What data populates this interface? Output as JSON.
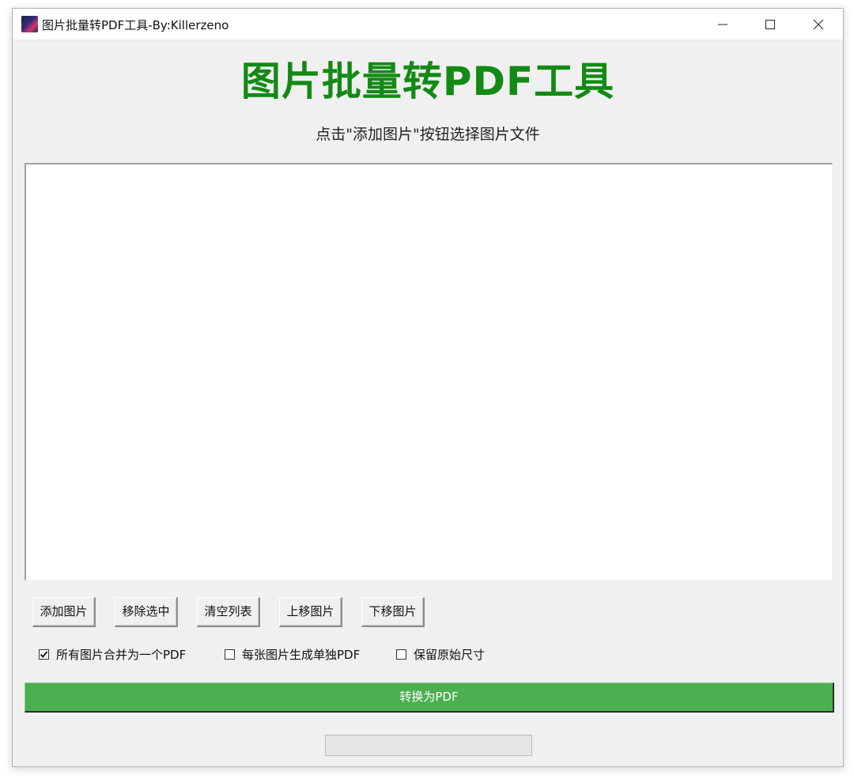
{
  "window": {
    "title": "图片批量转PDF工具-By:Killerzeno",
    "controls": [
      "minimize-icon",
      "maximize-icon",
      "close-icon"
    ]
  },
  "main": {
    "heading": "图片批量转PDF工具",
    "subtitle": "点击\"添加图片\"按钮选择图片文件",
    "heading_color": "#138a13"
  },
  "image_list": {
    "items": []
  },
  "toolbar": {
    "add_label": "添加图片",
    "remove_label": "移除选中",
    "clear_label": "清空列表",
    "move_up_label": "上移图片",
    "move_down_label": "下移图片"
  },
  "options": {
    "merge_all": {
      "label": "所有图片合并为一个PDF",
      "checked": true
    },
    "separate_each": {
      "label": "每张图片生成单独PDF",
      "checked": false
    },
    "keep_original_size": {
      "label": "保留原始尺寸",
      "checked": false
    }
  },
  "convert": {
    "label": "转换为PDF",
    "color": "#4caf50"
  },
  "progress": {
    "value": 0
  }
}
